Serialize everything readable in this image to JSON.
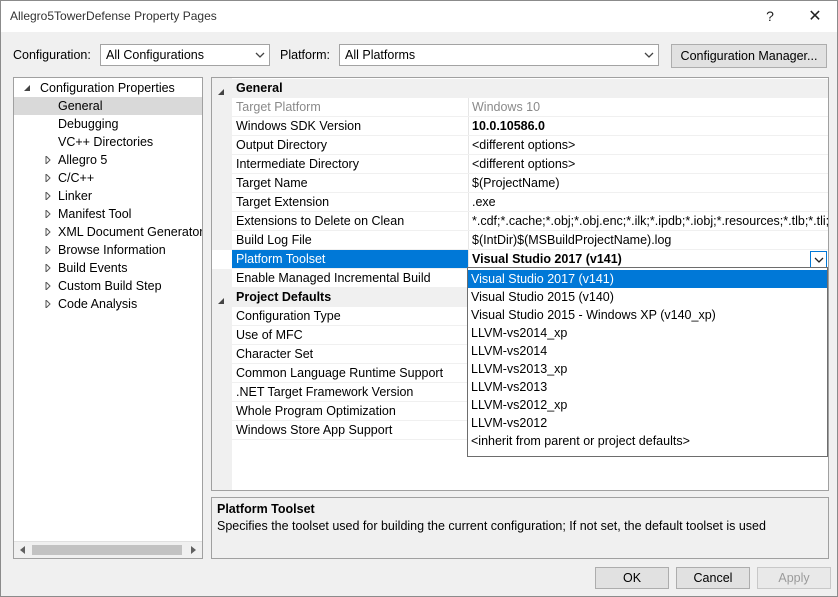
{
  "window": {
    "title": "Allegro5TowerDefense Property Pages",
    "help_glyph": "?",
    "close_glyph": "✕"
  },
  "toolbar": {
    "configuration_label": "Configuration:",
    "configuration_value": "All Configurations",
    "platform_label": "Platform:",
    "platform_value": "All Platforms",
    "config_manager_label": "Configuration Manager..."
  },
  "tree": {
    "root_label": "Configuration Properties",
    "items": [
      {
        "label": "General",
        "selected": true,
        "expandable": false
      },
      {
        "label": "Debugging",
        "expandable": false
      },
      {
        "label": "VC++ Directories",
        "expandable": false
      },
      {
        "label": "Allegro 5",
        "expandable": true
      },
      {
        "label": "C/C++",
        "expandable": true
      },
      {
        "label": "Linker",
        "expandable": true
      },
      {
        "label": "Manifest Tool",
        "expandable": true
      },
      {
        "label": "XML Document Generator",
        "expandable": true
      },
      {
        "label": "Browse Information",
        "expandable": true
      },
      {
        "label": "Build Events",
        "expandable": true
      },
      {
        "label": "Custom Build Step",
        "expandable": true
      },
      {
        "label": "Code Analysis",
        "expandable": true
      }
    ]
  },
  "grid": {
    "general_header": "General",
    "general_rows": [
      {
        "key": "Target Platform",
        "value": "Windows 10"
      },
      {
        "key": "Windows SDK Version",
        "value": "10.0.10586.0"
      },
      {
        "key": "Output Directory",
        "value": "<different options>"
      },
      {
        "key": "Intermediate Directory",
        "value": "<different options>"
      },
      {
        "key": "Target Name",
        "value": "$(ProjectName)"
      },
      {
        "key": "Target Extension",
        "value": ".exe"
      },
      {
        "key": "Extensions to Delete on Clean",
        "value": "*.cdf;*.cache;*.obj;*.obj.enc;*.ilk;*.ipdb;*.iobj;*.resources;*.tlb;*.tli;*.t"
      },
      {
        "key": "Build Log File",
        "value": "$(IntDir)$(MSBuildProjectName).log"
      },
      {
        "key": "Platform Toolset",
        "value": "Visual Studio 2017 (v141)"
      },
      {
        "key": "Enable Managed Incremental Build",
        "value": ""
      }
    ],
    "defaults_header": "Project Defaults",
    "defaults_rows": [
      {
        "key": "Configuration Type"
      },
      {
        "key": "Use of MFC"
      },
      {
        "key": "Character Set"
      },
      {
        "key": "Common Language Runtime Support"
      },
      {
        "key": ".NET Target Framework Version"
      },
      {
        "key": "Whole Program Optimization"
      },
      {
        "key": "Windows Store App Support"
      }
    ]
  },
  "toolset_dropdown": {
    "options": [
      "Visual Studio 2017 (v141)",
      "Visual Studio 2015 (v140)",
      "Visual Studio 2015 - Windows XP (v140_xp)",
      "LLVM-vs2014_xp",
      "LLVM-vs2014",
      "LLVM-vs2013_xp",
      "LLVM-vs2013",
      "LLVM-vs2012_xp",
      "LLVM-vs2012",
      "<inherit from parent or project defaults>"
    ],
    "selected": "Visual Studio 2017 (v141)"
  },
  "description": {
    "title": "Platform Toolset",
    "text": "Specifies the toolset used for building the current configuration; If not set, the default toolset is used"
  },
  "buttons": {
    "ok": "OK",
    "cancel": "Cancel",
    "apply": "Apply"
  },
  "colors": {
    "selection": "#0078d7",
    "dialog_bg": "#f0f0f0"
  }
}
